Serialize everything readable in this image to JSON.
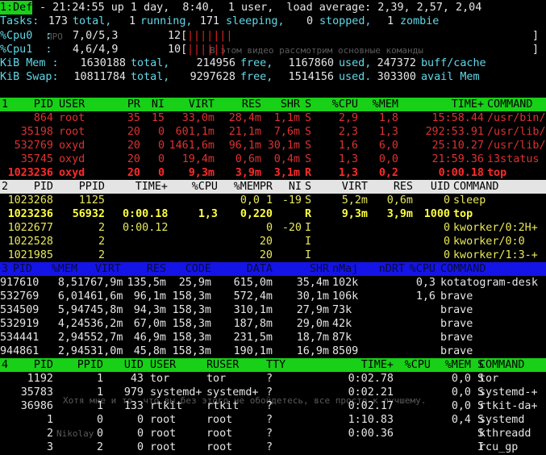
{
  "summary": {
    "tab_label": "1:Def",
    "uptime_line": " - 21:24:55 up 1 day,  8:40,  1 user,  load average: 2,39, 2,57, 2,04",
    "tasks": {
      "label": "Tasks:",
      "total": "173",
      "running": "1",
      "sleeping": "171",
      "stopped": "0",
      "zombie": "1"
    },
    "cpu0": {
      "label": "%Cpu0  :",
      "value": "7,0/5,3",
      "bar_count": "12[",
      "bar": "|||||||"
    },
    "cpu1": {
      "label": "%Cpu1  :",
      "value": "4,6/4,9",
      "bar_count": "10[",
      "bar": "||||||"
    },
    "mem": {
      "label": "KiB Mem :",
      "total": "1630188",
      "free": "214956",
      "used": "1167860",
      "cache": "247372"
    },
    "swap": {
      "label": "KiB Swap:",
      "total": "10811784",
      "free": "9297628",
      "used": "1514156",
      "avail": "303300"
    },
    "words": {
      "total": "total,",
      "running": "running,",
      "sleeping": "sleeping,",
      "stopped": "stopped,",
      "zombie": "zombie",
      "free": "free,",
      "used": "used,",
      "used2": "used.",
      "cache": "buff/cache",
      "avail": "avail Mem",
      "close": "]"
    }
  },
  "win1": {
    "tag": "1",
    "headers": [
      "PID",
      "USER",
      "PR",
      "NI",
      "VIRT",
      "RES",
      "SHR",
      "S",
      "%CPU",
      "%MEM",
      "TIME+",
      "COMMAND"
    ],
    "rows": [
      [
        "864",
        "root",
        "35",
        "15",
        "33,0m",
        "28,4m",
        "1,1m",
        "S",
        "2,9",
        "1,8",
        "15:58.44",
        "/usr/bin/p+"
      ],
      [
        "35198",
        "root",
        "20",
        "0",
        "601,1m",
        "21,1m",
        "7,6m",
        "S",
        "2,3",
        "1,3",
        "292:53.91",
        "/usr/lib/X+"
      ],
      [
        "532769",
        "oxyd",
        "20",
        "0",
        "1461,6m",
        "96,1m",
        "30,1m",
        "S",
        "1,6",
        "6,0",
        "25:10.27",
        "/usr/lib/b+"
      ],
      [
        "35745",
        "oxyd",
        "20",
        "0",
        "19,4m",
        "0,6m",
        "0,4m",
        "S",
        "1,3",
        "0,0",
        "21:59.36",
        "i3status"
      ],
      [
        "1023236",
        "oxyd",
        "20",
        "0",
        "9,3m",
        "3,9m",
        "3,1m",
        "R",
        "1,3",
        "0,2",
        "0:00.18",
        "top"
      ]
    ]
  },
  "win2": {
    "tag": "2",
    "headers": [
      "PID",
      "PPID",
      "TIME+",
      "%CPU",
      "%MEM",
      "PR",
      "NI",
      "S",
      "VIRT",
      "RES",
      "UID",
      "COMMAND"
    ],
    "rows": [
      [
        "1023268",
        "1125",
        "",
        "",
        "0,0",
        "1",
        "-19",
        "S",
        "5,2m",
        "0,6m",
        "0",
        "sleep"
      ],
      [
        "1023236",
        "56932",
        "0:00.18",
        "1,3",
        "0,2",
        "20",
        "",
        "R",
        "9,3m",
        "3,9m",
        "1000",
        "top"
      ],
      [
        "1022677",
        "2",
        "0:00.12",
        "",
        "",
        "0",
        "-20",
        "I",
        "",
        "",
        "0",
        "kworker/0:2H+"
      ],
      [
        "1022528",
        "2",
        "",
        "",
        "",
        "20",
        "",
        "I",
        "",
        "",
        "0",
        "kworker/0:0"
      ],
      [
        "1021985",
        "2",
        "",
        "",
        "",
        "20",
        "",
        "I",
        "",
        "",
        "0",
        "kworker/1:3-+"
      ]
    ]
  },
  "win3": {
    "tag": "3",
    "headers": [
      "PID",
      "%MEM",
      "VIRT",
      "RES",
      "CODE",
      "DATA",
      "SHR",
      "nMaj",
      "nDRT",
      "%CPU",
      "COMMAND"
    ],
    "rows": [
      [
        "917610",
        "8,5",
        "1767,9m",
        "135,5m",
        "25,9m",
        "615,0m",
        "35,4m",
        "102k",
        "",
        "0,3",
        "kotatogram-desk"
      ],
      [
        "532769",
        "6,0",
        "1461,6m",
        "96,1m",
        "158,3m",
        "572,4m",
        "30,1m",
        "106k",
        "",
        "1,6",
        "brave"
      ],
      [
        "534509",
        "5,9",
        "4745,8m",
        "94,3m",
        "158,3m",
        "310,1m",
        "27,9m",
        "73k",
        "",
        "",
        "brave"
      ],
      [
        "532919",
        "4,2",
        "4536,2m",
        "67,0m",
        "158,3m",
        "187,8m",
        "29,0m",
        "42k",
        "",
        "",
        "brave"
      ],
      [
        "534441",
        "2,9",
        "4552,7m",
        "46,9m",
        "158,3m",
        "231,5m",
        "18,7m",
        "87k",
        "",
        "",
        "brave"
      ],
      [
        "944861",
        "2,9",
        "4531,0m",
        "45,8m",
        "158,3m",
        "190,1m",
        "16,9m",
        "8509",
        "",
        "",
        "brave"
      ]
    ]
  },
  "win4": {
    "tag": "4",
    "headers": [
      "PID",
      "PPID",
      "UID",
      "USER",
      "RUSER",
      "TTY",
      "TIME+",
      "%CPU",
      "%MEM",
      "S",
      "COMMAND"
    ],
    "rows": [
      [
        "1192",
        "1",
        "43",
        "tor",
        "tor",
        "?",
        "0:02.78",
        "",
        "0,0",
        "S",
        "tor"
      ],
      [
        "35783",
        "1",
        "979",
        "systemd+",
        "systemd+",
        "?",
        "0:02.21",
        "",
        "0,0",
        "S",
        "systemd-+"
      ],
      [
        "36986",
        "1",
        "133",
        "rtkit",
        "rtkit",
        "?",
        "0:02.17",
        "",
        "0,0",
        "S",
        "rtkit-da+"
      ],
      [
        "1",
        "0",
        "0",
        "root",
        "root",
        "?",
        "1:10.83",
        "",
        "0,4",
        "S",
        "systemd"
      ],
      [
        "2",
        "0",
        "0",
        "root",
        "root",
        "?",
        "0:00.36",
        "",
        "",
        "S",
        "kthreadd"
      ],
      [
        "3",
        "2",
        "0",
        "root",
        "root",
        "?",
        "",
        "",
        "",
        "I",
        "rcu_gp"
      ]
    ]
  },
  "overlay": {
    "l1": "В этом видео рассмотрим основные команды",
    "l2": "Хотя мне и то, что вы без этого не обойдетесь, все просто к лучшему.",
    "l3": "Nikolay",
    "l4": "ПРО"
  },
  "colors": {
    "green_header": "#18d018",
    "white_header": "#e4e4e4",
    "blue_header": "#1414e6",
    "red_rows": "#e03030",
    "yellow_rows": "#e8e85a",
    "cyan_summary": "#60d8e8"
  }
}
